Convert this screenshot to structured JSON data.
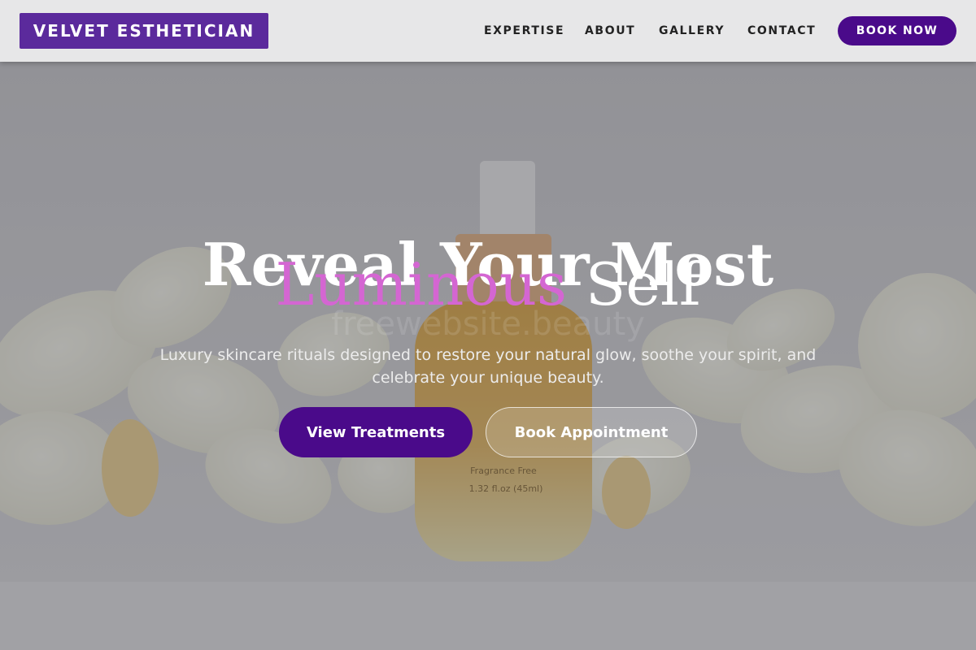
{
  "header": {
    "logo": "VELVET ESTHETICIAN",
    "nav": [
      "EXPERTISE",
      "ABOUT",
      "GALLERY",
      "CONTACT"
    ],
    "cta": "BOOK NOW"
  },
  "hero": {
    "watermark": "freewebsite.beauty",
    "headline_line1": "Reveal Your Most",
    "headline_accent": "Luminous",
    "headline_rest": " Self",
    "subtitle_line1": "Luxury skincare rituals designed to restore your natural glow, soothe your spirit, and",
    "subtitle_line2": "celebrate your unique beauty.",
    "primary_button": "View Treatments",
    "secondary_button": "Book Appointment",
    "bottle_label_1": "Fragrance Free",
    "bottle_label_2": "1.32 fl.oz (45ml)"
  },
  "colors": {
    "brand_purple": "#4a0a8a",
    "logo_purple": "#5b2a9c",
    "accent_pink": "#d466d2",
    "header_bg": "#e7e7e8"
  }
}
